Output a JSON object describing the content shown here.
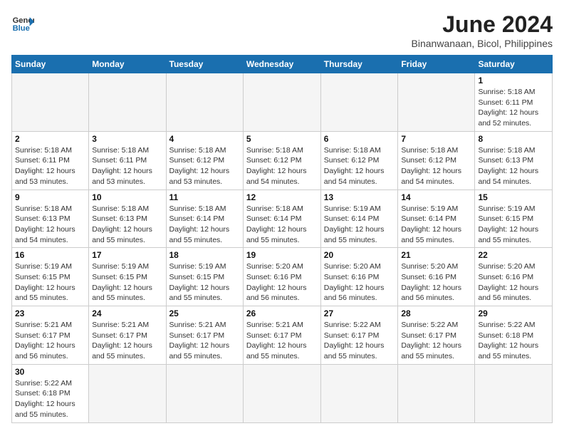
{
  "header": {
    "logo_general": "General",
    "logo_blue": "Blue",
    "month_title": "June 2024",
    "subtitle": "Binanwanaan, Bicol, Philippines"
  },
  "weekdays": [
    "Sunday",
    "Monday",
    "Tuesday",
    "Wednesday",
    "Thursday",
    "Friday",
    "Saturday"
  ],
  "weeks": [
    [
      null,
      null,
      null,
      null,
      null,
      null,
      {
        "day": "1",
        "sunrise": "5:18 AM",
        "sunset": "6:11 PM",
        "daylight": "12 hours and 52 minutes."
      }
    ],
    [
      {
        "day": "2",
        "sunrise": "5:18 AM",
        "sunset": "6:11 PM",
        "daylight": "12 hours and 53 minutes."
      },
      {
        "day": "3",
        "sunrise": "5:18 AM",
        "sunset": "6:11 PM",
        "daylight": "12 hours and 53 minutes."
      },
      {
        "day": "4",
        "sunrise": "5:18 AM",
        "sunset": "6:12 PM",
        "daylight": "12 hours and 53 minutes."
      },
      {
        "day": "5",
        "sunrise": "5:18 AM",
        "sunset": "6:12 PM",
        "daylight": "12 hours and 54 minutes."
      },
      {
        "day": "6",
        "sunrise": "5:18 AM",
        "sunset": "6:12 PM",
        "daylight": "12 hours and 54 minutes."
      },
      {
        "day": "7",
        "sunrise": "5:18 AM",
        "sunset": "6:12 PM",
        "daylight": "12 hours and 54 minutes."
      },
      {
        "day": "8",
        "sunrise": "5:18 AM",
        "sunset": "6:13 PM",
        "daylight": "12 hours and 54 minutes."
      }
    ],
    [
      {
        "day": "9",
        "sunrise": "5:18 AM",
        "sunset": "6:13 PM",
        "daylight": "12 hours and 54 minutes."
      },
      {
        "day": "10",
        "sunrise": "5:18 AM",
        "sunset": "6:13 PM",
        "daylight": "12 hours and 55 minutes."
      },
      {
        "day": "11",
        "sunrise": "5:18 AM",
        "sunset": "6:14 PM",
        "daylight": "12 hours and 55 minutes."
      },
      {
        "day": "12",
        "sunrise": "5:18 AM",
        "sunset": "6:14 PM",
        "daylight": "12 hours and 55 minutes."
      },
      {
        "day": "13",
        "sunrise": "5:19 AM",
        "sunset": "6:14 PM",
        "daylight": "12 hours and 55 minutes."
      },
      {
        "day": "14",
        "sunrise": "5:19 AM",
        "sunset": "6:14 PM",
        "daylight": "12 hours and 55 minutes."
      },
      {
        "day": "15",
        "sunrise": "5:19 AM",
        "sunset": "6:15 PM",
        "daylight": "12 hours and 55 minutes."
      }
    ],
    [
      {
        "day": "16",
        "sunrise": "5:19 AM",
        "sunset": "6:15 PM",
        "daylight": "12 hours and 55 minutes."
      },
      {
        "day": "17",
        "sunrise": "5:19 AM",
        "sunset": "6:15 PM",
        "daylight": "12 hours and 55 minutes."
      },
      {
        "day": "18",
        "sunrise": "5:19 AM",
        "sunset": "6:15 PM",
        "daylight": "12 hours and 55 minutes."
      },
      {
        "day": "19",
        "sunrise": "5:20 AM",
        "sunset": "6:16 PM",
        "daylight": "12 hours and 56 minutes."
      },
      {
        "day": "20",
        "sunrise": "5:20 AM",
        "sunset": "6:16 PM",
        "daylight": "12 hours and 56 minutes."
      },
      {
        "day": "21",
        "sunrise": "5:20 AM",
        "sunset": "6:16 PM",
        "daylight": "12 hours and 56 minutes."
      },
      {
        "day": "22",
        "sunrise": "5:20 AM",
        "sunset": "6:16 PM",
        "daylight": "12 hours and 56 minutes."
      }
    ],
    [
      {
        "day": "23",
        "sunrise": "5:21 AM",
        "sunset": "6:17 PM",
        "daylight": "12 hours and 56 minutes."
      },
      {
        "day": "24",
        "sunrise": "5:21 AM",
        "sunset": "6:17 PM",
        "daylight": "12 hours and 55 minutes."
      },
      {
        "day": "25",
        "sunrise": "5:21 AM",
        "sunset": "6:17 PM",
        "daylight": "12 hours and 55 minutes."
      },
      {
        "day": "26",
        "sunrise": "5:21 AM",
        "sunset": "6:17 PM",
        "daylight": "12 hours and 55 minutes."
      },
      {
        "day": "27",
        "sunrise": "5:22 AM",
        "sunset": "6:17 PM",
        "daylight": "12 hours and 55 minutes."
      },
      {
        "day": "28",
        "sunrise": "5:22 AM",
        "sunset": "6:17 PM",
        "daylight": "12 hours and 55 minutes."
      },
      {
        "day": "29",
        "sunrise": "5:22 AM",
        "sunset": "6:18 PM",
        "daylight": "12 hours and 55 minutes."
      }
    ],
    [
      {
        "day": "30",
        "sunrise": "5:22 AM",
        "sunset": "6:18 PM",
        "daylight": "12 hours and 55 minutes."
      },
      null,
      null,
      null,
      null,
      null,
      null
    ]
  ],
  "labels": {
    "sunrise": "Sunrise:",
    "sunset": "Sunset:",
    "daylight": "Daylight:"
  }
}
